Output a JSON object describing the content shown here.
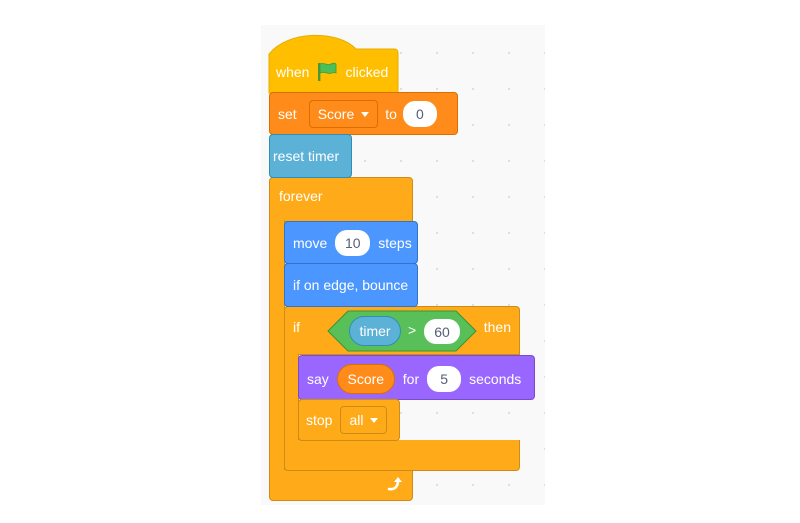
{
  "script": {
    "hat": {
      "when": "when",
      "flag_icon": "green-flag-icon",
      "clicked": "clicked"
    },
    "set_var": {
      "set": "set",
      "variable": "Score",
      "to": "to",
      "value": "0"
    },
    "reset_timer": {
      "label": "reset timer"
    },
    "forever": {
      "label": "forever",
      "loop_icon": "loop-arrow-icon"
    },
    "move": {
      "move": "move",
      "steps_value": "10",
      "steps": "steps"
    },
    "bounce": {
      "label": "if on edge, bounce"
    },
    "if_block": {
      "if": "if",
      "then": "then",
      "condition": {
        "left": "timer",
        "operator": ">",
        "right": "60"
      }
    },
    "say": {
      "say": "say",
      "message": "Score",
      "for": "for",
      "seconds_value": "5",
      "seconds": "seconds"
    },
    "stop": {
      "stop": "stop",
      "option": "all"
    }
  },
  "colors": {
    "events": "#ffbf00",
    "variables": "#ff8c1a",
    "sensing": "#5cb1d6",
    "control": "#ffab19",
    "motion": "#4c97ff",
    "looks": "#9966ff",
    "operators": "#59c059"
  }
}
